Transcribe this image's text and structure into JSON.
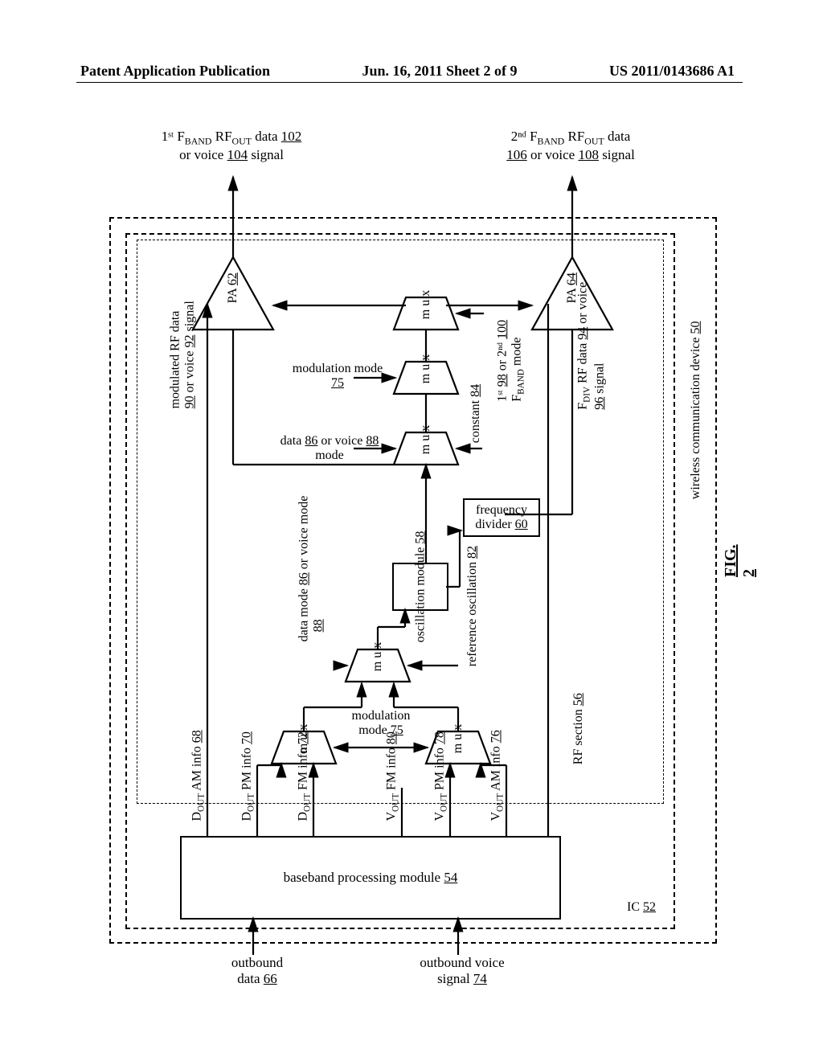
{
  "header": {
    "left": "Patent Application Publication",
    "center": "Jun. 16, 2011  Sheet 2 of 9",
    "right": "US 2011/0143686 A1"
  },
  "figure_label": "FIG. 2",
  "top_outputs": {
    "left_line1": "1ˢᵗ F",
    "left_sub1": "BAND",
    "left_mid": " RF",
    "left_sub2": "OUT",
    "left_end": " data ",
    "left_ref1": "102",
    "left_line2a": "or voice ",
    "left_ref2": "104",
    "left_line2b": " signal",
    "right_line1": "2ⁿᵈ F",
    "right_sub1": "BAND",
    "right_mid": " RF",
    "right_sub2": "OUT",
    "right_end": " data",
    "right_ref1": "106",
    "right_line2a": " or voice ",
    "right_ref2": "108",
    "right_line2b": " signal"
  },
  "boxes": {
    "wireless_device": "wireless communication device ",
    "wireless_device_ref": "50",
    "ic": "IC ",
    "ic_ref": "52",
    "rf_section": "RF section ",
    "rf_section_ref": "56",
    "baseband": "baseband processing module ",
    "baseband_ref": "54",
    "oscillation": "oscillation module ",
    "oscillation_ref": "58",
    "freq_div": "frequency divider ",
    "freq_div_ref": "60"
  },
  "pa": {
    "left": "PA",
    "left_ref": "62",
    "right": "PA",
    "right_ref": "64"
  },
  "mux_label": "m u x",
  "labels": {
    "mod_rf_l1": "modulated RF data",
    "mod_rf_ref1": "90",
    "mod_rf_mid": " or voice ",
    "mod_rf_ref2": "92",
    "mod_rf_end": " signal",
    "modulation_mode": "modulation mode ",
    "modulation_mode_ref": "75",
    "constant": "constant ",
    "constant_ref": "84",
    "data_or_voice": "data ",
    "data_or_voice_ref1": "86",
    "data_or_voice_mid": " or voice ",
    "data_or_voice_ref2": "88",
    "data_or_voice_end": " mode",
    "fband_mode_pre": "1ˢᵗ ",
    "fband_mode_ref1": "98",
    "fband_mode_mid": " or 2ⁿᵈ ",
    "fband_mode_ref2": "100",
    "fband_mode_end": " F",
    "fband_mode_sub": "BAND",
    "fband_mode_end2": " mode",
    "fdiv_rf": "F",
    "fdiv_sub": "DIV",
    "fdiv_mid": " RF data ",
    "fdiv_ref1": "94",
    "fdiv_mid2": " or voice ",
    "fdiv_ref2": "96",
    "fdiv_end": " signal",
    "data_voice_mode_l1": "data mode ",
    "data_voice_mode_ref1": "86",
    "data_voice_mode_mid": " or voice mode ",
    "data_voice_mode_ref2": "88",
    "ref_osc": "reference oscillation ",
    "ref_osc_ref": "82"
  },
  "bb_outputs": {
    "dout_am": "D",
    "dout_am_sub": "OUT",
    "dout_am_mid": " AM info ",
    "dout_am_ref": "68",
    "dout_pm": "D",
    "dout_pm_sub": "OUT",
    "dout_pm_mid": " PM info ",
    "dout_pm_ref": "70",
    "dout_fm": "D",
    "dout_fm_sub": "OUT",
    "dout_fm_mid": " FM info ",
    "dout_fm_ref": "72",
    "vout_fm": "V",
    "vout_fm_sub": "OUT",
    "vout_fm_mid": " FM info ",
    "vout_fm_ref": "80",
    "vout_pm": "V",
    "vout_pm_sub": "OUT",
    "vout_pm_mid": " PM info ",
    "vout_pm_ref": "78",
    "vout_am": "V",
    "vout_am_sub": "OUT",
    "vout_am_mid": " AM info ",
    "vout_am_ref": "76"
  },
  "bottom_inputs": {
    "left_l1": "outbound",
    "left_l2a": "data ",
    "left_l2_ref": "66",
    "right_l1": "outbound voice",
    "right_l2a": "signal ",
    "right_l2_ref": "74"
  }
}
